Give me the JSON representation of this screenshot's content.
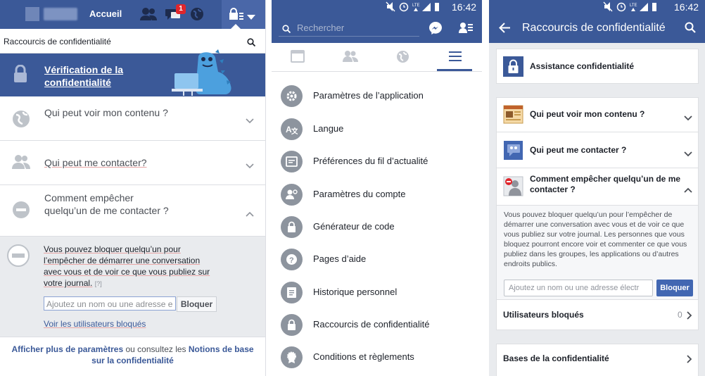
{
  "panel1": {
    "header": {
      "home_label": "Accueil",
      "notification_count": "1"
    },
    "search_title": "Raccourcis de confidentialité",
    "banner_title": "Vérification de la confidentialité",
    "rows": [
      {
        "label": "Qui peut voir mon contenu ?"
      },
      {
        "label": "Qui peut me contacter?"
      },
      {
        "label": "Comment empêcher quelqu’un de me contacter ?"
      }
    ],
    "expanded": {
      "description": "Vous pouvez bloquer quelqu’un pour l’empêcher de démarrer une conversation avec vous et de voir ce que vous publiez sur votre journal.",
      "help_marker": "[?]",
      "input_placeholder": "Ajoutez un nom ou une adresse e",
      "block_button": "Bloquer",
      "blocked_link": "Voir les utilisateurs bloqués"
    },
    "footer": {
      "more_settings": "Afficher plus de paramètres",
      "middle": " ou consultez les ",
      "basics_link": "Notions de base sur la confidentialité"
    }
  },
  "panel2": {
    "status_time": "16:42",
    "search_placeholder": "Rechercher",
    "menu": [
      {
        "label": "Paramètres de l’application",
        "icon": "gear-icon"
      },
      {
        "label": "Langue",
        "icon": "translate-icon"
      },
      {
        "label": "Préférences du fil d’actualité",
        "icon": "feed-icon"
      },
      {
        "label": "Paramètres du compte",
        "icon": "account-settings-icon"
      },
      {
        "label": "Générateur de code",
        "icon": "code-lock-icon"
      },
      {
        "label": "Pages d’aide",
        "icon": "help-icon"
      },
      {
        "label": "Historique personnel",
        "icon": "history-icon"
      },
      {
        "label": "Raccourcis de confidentialité",
        "icon": "lock-icon"
      },
      {
        "label": "Conditions et règlements",
        "icon": "terms-icon"
      }
    ]
  },
  "panel3": {
    "status_time": "16:42",
    "title": "Raccourcis de confidentialité",
    "assistance": "Assistance confidentialité",
    "sections": [
      {
        "label": "Qui peut voir mon contenu ?"
      },
      {
        "label": "Qui peut me contacter ?"
      },
      {
        "label": "Comment empêcher quelqu’un de me contacter ?"
      }
    ],
    "expanded": {
      "description": "Vous pouvez bloquer quelqu’un pour l’empêcher de démarrer une conversation avec vous et de voir ce que vous publiez sur votre journal. Les personnes que vous bloquez pourront encore voir et commenter ce que vous publiez dans les groupes, les applications ou d’autres endroits publics.",
      "input_placeholder": "Ajoutez un nom ou une adresse électr",
      "block_button": "Bloquer",
      "blocked_label": "Utilisateurs bloqués",
      "blocked_count": "0"
    },
    "basics": "Bases de la confidentialité"
  },
  "colors": {
    "brand": "#3b5998",
    "light_bg": "#e9ebee",
    "badge_red": "#e0262c"
  }
}
